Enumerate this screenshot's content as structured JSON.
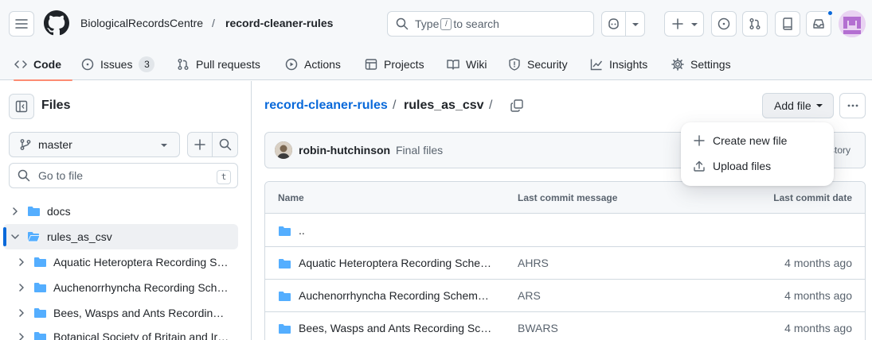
{
  "header": {
    "owner": "BiologicalRecordsCentre",
    "separator": "/",
    "repo": "record-cleaner-rules",
    "search_prefix": "Type",
    "search_key": "/",
    "search_suffix": "to search"
  },
  "tabs": [
    {
      "label": "Code",
      "icon": "code-icon",
      "active": true
    },
    {
      "label": "Issues",
      "icon": "issue-icon",
      "count": "3"
    },
    {
      "label": "Pull requests",
      "icon": "pull-request-icon"
    },
    {
      "label": "Actions",
      "icon": "play-icon"
    },
    {
      "label": "Projects",
      "icon": "table-icon"
    },
    {
      "label": "Wiki",
      "icon": "book-icon"
    },
    {
      "label": "Security",
      "icon": "shield-icon"
    },
    {
      "label": "Insights",
      "icon": "graph-icon"
    },
    {
      "label": "Settings",
      "icon": "gear-icon"
    }
  ],
  "sidebar": {
    "title": "Files",
    "branch": "master",
    "goto_placeholder": "Go to file",
    "goto_key": "t",
    "tree": [
      {
        "label": "docs",
        "expanded": false,
        "level": 0
      },
      {
        "label": "rules_as_csv",
        "expanded": true,
        "level": 0,
        "selected": true
      },
      {
        "label": "Aquatic Heteroptera Recording S…",
        "level": 1
      },
      {
        "label": "Auchenorrhyncha Recording Sch…",
        "level": 1
      },
      {
        "label": "Bees, Wasps and Ants Recording…",
        "level": 1
      },
      {
        "label": "Botanical Society of Britain and Ir…",
        "level": 1
      }
    ]
  },
  "main": {
    "breadcrumb_repo": "record-cleaner-rules",
    "breadcrumb_sep": "/",
    "breadcrumb_folder": "rules_as_csv",
    "add_file_label": "Add file",
    "commit": {
      "user": "robin-hutchinson",
      "message": "Final files",
      "history": "istory"
    },
    "table": {
      "headers": {
        "name": "Name",
        "message": "Last commit message",
        "date": "Last commit date"
      },
      "parent": "..",
      "rows": [
        {
          "name": "Aquatic Heteroptera Recording Sche…",
          "message": "AHRS",
          "date": "4 months ago"
        },
        {
          "name": "Auchenorrhyncha Recording Schem…",
          "message": "ARS",
          "date": "4 months ago"
        },
        {
          "name": "Bees, Wasps and Ants Recording Sc…",
          "message": "BWARS",
          "date": "4 months ago"
        }
      ]
    }
  },
  "dropdown": {
    "items": [
      {
        "label": "Create new file",
        "icon": "plus-icon"
      },
      {
        "label": "Upload files",
        "icon": "upload-icon"
      }
    ]
  },
  "colors": {
    "accent_link": "#0969da",
    "folder": "#54aeff",
    "tab_underline": "#fd8c73"
  }
}
